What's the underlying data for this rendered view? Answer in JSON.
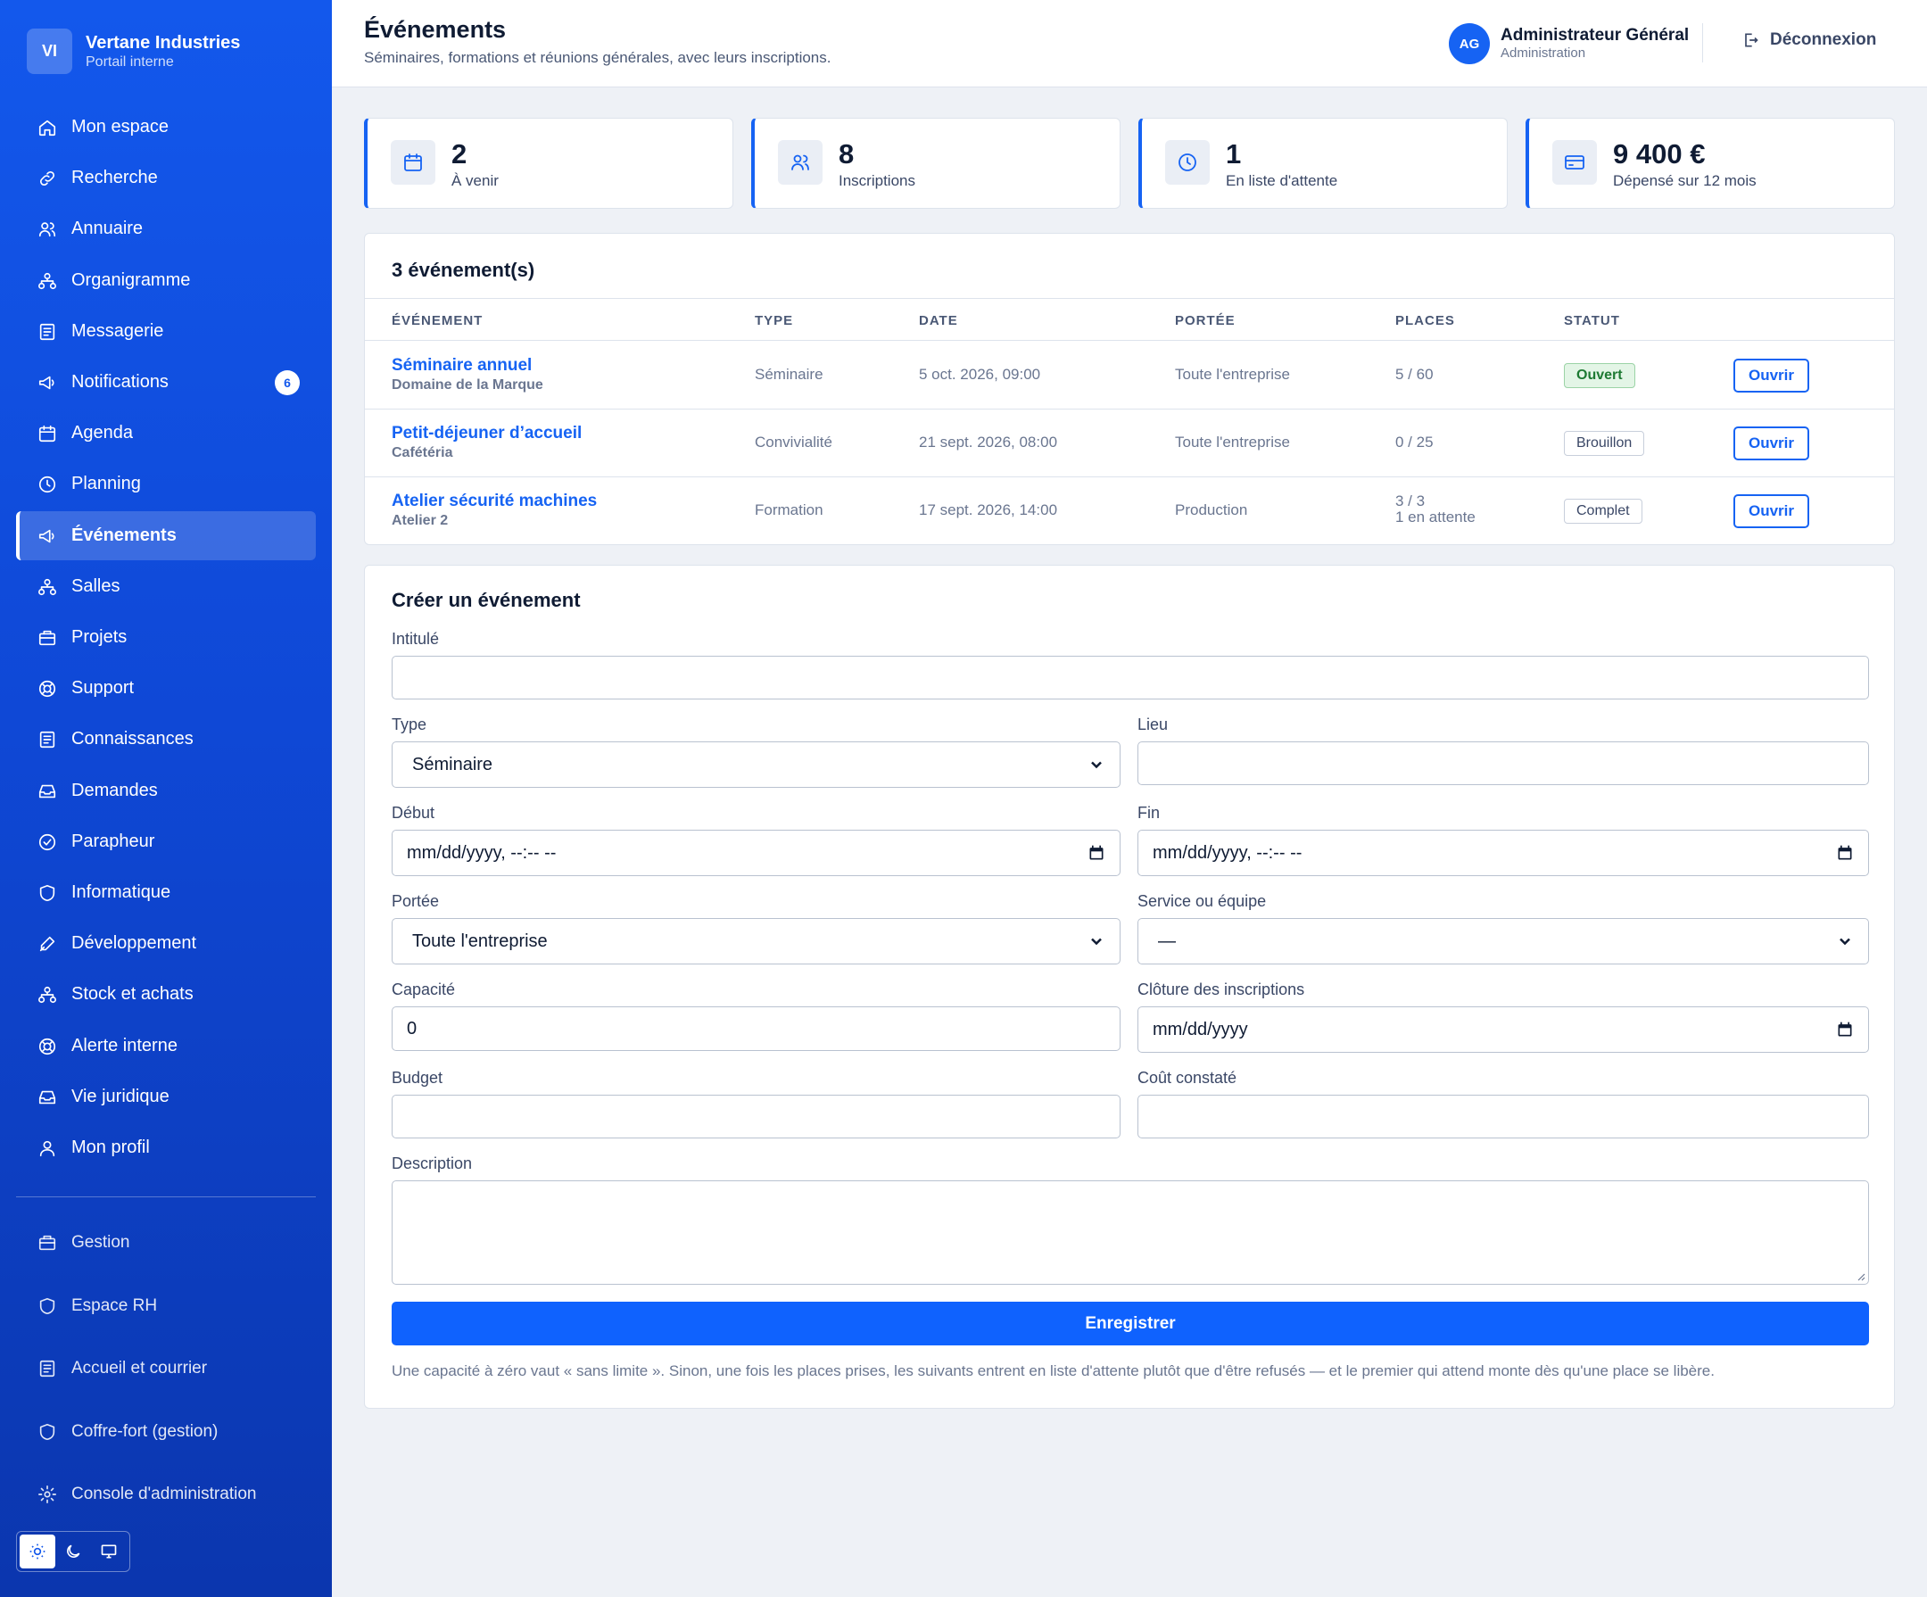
{
  "brand": {
    "initials": "VI",
    "name": "Vertane Industries",
    "subtitle": "Portail interne"
  },
  "nav": [
    {
      "label": "Mon espace",
      "icon": "home-icon"
    },
    {
      "label": "Recherche",
      "icon": "link-icon"
    },
    {
      "label": "Annuaire",
      "icon": "users-icon"
    },
    {
      "label": "Organigramme",
      "icon": "org-chart-icon"
    },
    {
      "label": "Messagerie",
      "icon": "document-icon"
    },
    {
      "label": "Notifications",
      "icon": "megaphone-icon",
      "badge": "6"
    },
    {
      "label": "Agenda",
      "icon": "calendar-icon"
    },
    {
      "label": "Planning",
      "icon": "clock-icon"
    },
    {
      "label": "Événements",
      "icon": "megaphone-icon",
      "active": true
    },
    {
      "label": "Salles",
      "icon": "org-chart-icon"
    },
    {
      "label": "Projets",
      "icon": "briefcase-icon"
    },
    {
      "label": "Support",
      "icon": "lifebuoy-icon"
    },
    {
      "label": "Connaissances",
      "icon": "document-icon"
    },
    {
      "label": "Demandes",
      "icon": "inbox-icon"
    },
    {
      "label": "Parapheur",
      "icon": "check-circle-icon"
    },
    {
      "label": "Informatique",
      "icon": "shield-icon"
    },
    {
      "label": "Développement",
      "icon": "pen-icon"
    },
    {
      "label": "Stock et achats",
      "icon": "org-chart-icon"
    },
    {
      "label": "Alerte interne",
      "icon": "lifebuoy-icon"
    },
    {
      "label": "Vie juridique",
      "icon": "inbox-icon"
    },
    {
      "label": "Mon profil",
      "icon": "user-icon"
    }
  ],
  "bottom_nav": [
    {
      "label": "Gestion",
      "icon": "briefcase-icon"
    },
    {
      "label": "Espace RH",
      "icon": "shield-icon"
    },
    {
      "label": "Accueil et courrier",
      "icon": "document-icon"
    },
    {
      "label": "Coffre-fort (gestion)",
      "icon": "shield-icon"
    },
    {
      "label": "Console d'administration",
      "icon": "gear-icon"
    }
  ],
  "header": {
    "title": "Événements",
    "subtitle": "Séminaires, formations et réunions générales, avec leurs inscriptions.",
    "user": {
      "initials": "AG",
      "name": "Administrateur Général",
      "role": "Administration"
    },
    "logout": "Déconnexion"
  },
  "stats": [
    {
      "value": "2",
      "label": "À venir",
      "icon": "calendar-icon"
    },
    {
      "value": "8",
      "label": "Inscriptions",
      "icon": "users-icon"
    },
    {
      "value": "1",
      "label": "En liste d'attente",
      "icon": "clock-icon"
    },
    {
      "value": "9 400 €",
      "label": "Dépensé sur 12 mois",
      "icon": "credit-card-icon"
    }
  ],
  "events": {
    "title": "3 événement(s)",
    "columns": [
      "ÉVÉNEMENT",
      "TYPE",
      "DATE",
      "PORTÉE",
      "PLACES",
      "STATUT"
    ],
    "open_label": "Ouvrir",
    "rows": [
      {
        "name": "Séminaire annuel",
        "place": "Domaine de la Marque",
        "type": "Séminaire",
        "date": "5 oct. 2026, 09:00",
        "scope": "Toute l'entreprise",
        "seats": "5 / 60",
        "seats_note": "",
        "status": "Ouvert",
        "status_kind": "open"
      },
      {
        "name": "Petit-déjeuner d’accueil",
        "place": "Cafétéria",
        "type": "Convivialité",
        "date": "21 sept. 2026, 08:00",
        "scope": "Toute l'entreprise",
        "seats": "0 / 25",
        "seats_note": "",
        "status": "Brouillon",
        "status_kind": "neutral"
      },
      {
        "name": "Atelier sécurité machines",
        "place": "Atelier 2",
        "type": "Formation",
        "date": "17 sept. 2026, 14:00",
        "scope": "Production",
        "seats": "3 / 3",
        "seats_note": "1 en attente",
        "status": "Complet",
        "status_kind": "neutral"
      }
    ]
  },
  "form": {
    "title": "Créer un événement",
    "fields": {
      "intitule": {
        "label": "Intitulé",
        "value": ""
      },
      "type": {
        "label": "Type",
        "value": "Séminaire"
      },
      "lieu": {
        "label": "Lieu",
        "value": ""
      },
      "debut": {
        "label": "Début",
        "value": "mm/dd/yyyy, --:-- --"
      },
      "fin": {
        "label": "Fin",
        "value": "mm/dd/yyyy, --:-- --"
      },
      "portee": {
        "label": "Portée",
        "value": "Toute l'entreprise"
      },
      "service": {
        "label": "Service ou équipe",
        "value": "—"
      },
      "capacite": {
        "label": "Capacité",
        "value": "0"
      },
      "cloture": {
        "label": "Clôture des inscriptions",
        "value": "mm/dd/yyyy"
      },
      "budget": {
        "label": "Budget",
        "value": ""
      },
      "cout": {
        "label": "Coût constaté",
        "value": ""
      },
      "description": {
        "label": "Description",
        "value": ""
      }
    },
    "submit": "Enregistrer",
    "help": "Une capacité à zéro vaut « sans limite ». Sinon, une fois les places prises, les suivants entrent en liste d'attente plutôt que d'être refusés — et le premier qui attend monte dès qu'une place se libère."
  },
  "colors": {
    "sidebar": "#1358ec",
    "accent": "#1663f3",
    "open_badge": "#e3f5e6"
  }
}
